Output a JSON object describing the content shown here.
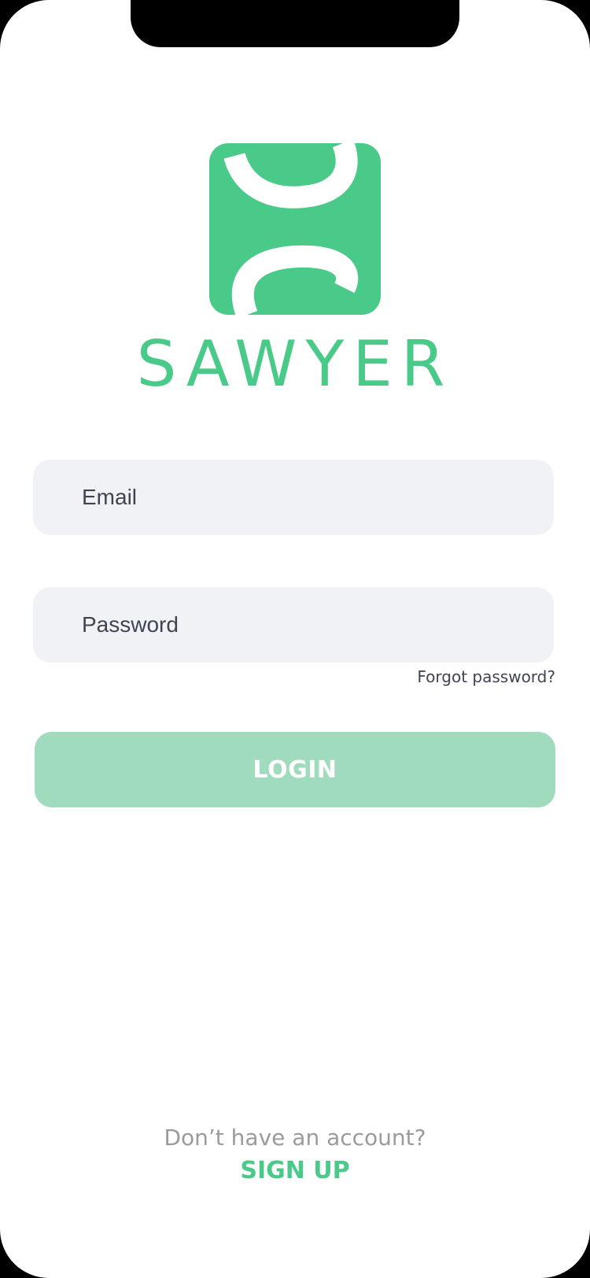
{
  "brand": {
    "name": "SAWYER",
    "color": "#4aca88",
    "logo_icon": "sawyer-logo-icon"
  },
  "login_form": {
    "email": {
      "placeholder": "Email",
      "value": ""
    },
    "password": {
      "placeholder": "Password",
      "value": ""
    },
    "forgot_password_label": "Forgot password?",
    "login_label": "LOGIN",
    "login_button_color": "#a1dbbd"
  },
  "signup": {
    "prompt": "Don’t have an account?",
    "label": "SIGN UP"
  },
  "colors": {
    "field_background": "#f1f2f5",
    "text_dark": "#3e4451",
    "text_muted": "#9b9b9b"
  }
}
